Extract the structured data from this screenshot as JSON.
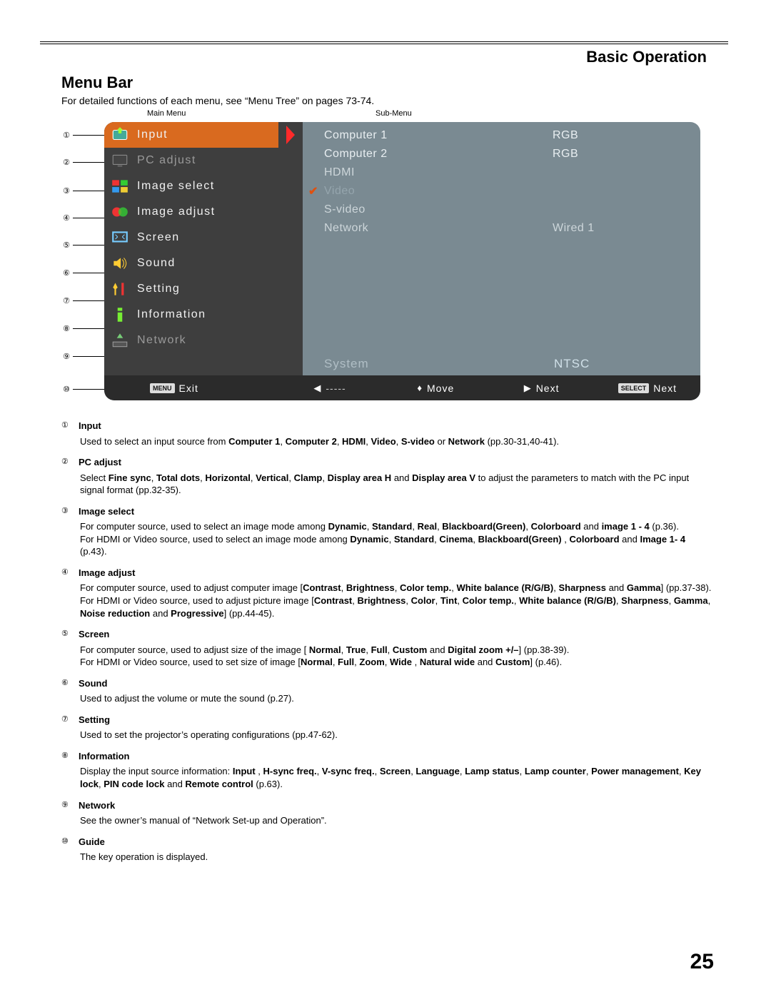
{
  "header": {
    "section": "Basic Operation",
    "title": "Menu Bar",
    "intro": "For detailed functions of each menu, see “Menu Tree” on pages 73-74.",
    "main_label": "Main Menu",
    "sub_label": "Sub-Menu"
  },
  "menu": {
    "items": [
      {
        "label": "Input",
        "selected": true
      },
      {
        "label": "PC adjust",
        "dim": true
      },
      {
        "label": "Image select"
      },
      {
        "label": "Image adjust"
      },
      {
        "label": "Screen"
      },
      {
        "label": "Sound"
      },
      {
        "label": "Setting"
      },
      {
        "label": "Information"
      },
      {
        "label": "Network",
        "dim": true
      }
    ]
  },
  "submenu": {
    "items": [
      {
        "label": "Computer 1",
        "value": "RGB",
        "bright": true
      },
      {
        "label": "Computer 2",
        "value": "RGB",
        "bright": true
      },
      {
        "label": "HDMI",
        "value": ""
      },
      {
        "label": "Video",
        "value": "",
        "checked": true,
        "dim": true
      },
      {
        "label": "S-video",
        "value": ""
      },
      {
        "label": "Network",
        "value": "Wired 1"
      }
    ],
    "system": {
      "label": "System",
      "value": "NTSC"
    }
  },
  "guide": {
    "exit_tag": "MENU",
    "exit": "Exit",
    "move": "Move",
    "next": "Next",
    "select_tag": "SELECT",
    "select": "Next",
    "dashes": "-----"
  },
  "descriptions": [
    {
      "num": "①",
      "head": "Input",
      "html": "Used to select an input source from <b>Computer 1</b>, <b>Computer 2</b>, <b>HDMI</b>, <b>Video</b>, <b>S-video</b> or <b>Network</b> (pp.30-31,40-41)."
    },
    {
      "num": "②",
      "head": "PC adjust",
      "html": "Select <b>Fine sync</b>, <b>Total dots</b>, <b>Horizontal</b>, <b>Vertical</b>, <b>Clamp</b>, <b>Display area H</b> and <b>Display area V</b> to adjust the parameters to match with the PC input signal format (pp.32-35)."
    },
    {
      "num": "③",
      "head": "Image select",
      "html": "For computer source, used to select an image mode among <b>Dynamic</b>, <b>Standard</b>, <b>Real</b>, <b>Blackboard(Green)</b>, <b>Colorboard</b> and <b>image 1 - 4</b> (p.36).<br>For HDMI or Video source, used to select an image mode among <b>Dynamic</b>, <b>Standard</b>, <b>Cinema</b>, <b>Blackboard(Green)</b> , <b>Colorboard</b> and <b>Image 1- 4</b> (p.43)."
    },
    {
      "num": "④",
      "head": "Image adjust",
      "html": "For computer source, used to adjust computer image [<b>Contrast</b>, <b>Brightness</b>, <b>Color temp.</b>, <b>White balance (R/G/B)</b>, <b>Sharpness</b> and <b>Gamma</b>] (pp.37-38).<br>For HDMI or Video source, used to adjust picture image [<b>Contrast</b>, <b>Brightness</b>, <b>Color</b>, <b>Tint</b>, <b>Color temp.</b>, <b>White balance (R/G/B)</b>, <b>Sharpness</b>, <b>Gamma</b>, <b>Noise reduction</b> and <b>Progressive</b>] (pp.44-45)."
    },
    {
      "num": "⑤",
      "head": "Screen",
      "html": "For computer source, used to adjust size of the image [ <b>Normal</b>, <b>True</b>, <b>Full</b>, <b>Custom</b> and <b>Digital zoom +/–</b>] (pp.38-39).<br>For HDMI or Video source, used to set size of image [<b>Normal</b>, <b>Full</b>, <b>Zoom</b>, <b>Wide</b> , <b>Natural wide</b> and <b>Custom</b>] (p.46)."
    },
    {
      "num": "⑥",
      "head": "Sound",
      "html": "Used to adjust the volume or mute the sound (p.27)."
    },
    {
      "num": "⑦",
      "head": "Setting",
      "html": "Used to set the projector’s operating configurations (pp.47-62)."
    },
    {
      "num": "⑧",
      "head": "Information",
      "html": "Display the input source information: <b>Input</b> , <b>H-sync freq.</b>, <b>V-sync freq.</b>, <b>Screen</b>, <b>Language</b>, <b>Lamp status</b>, <b>Lamp counter</b>, <b>Power management</b>, <b>Key lock</b>, <b>PIN code lock</b> and <b>Remote control</b> (p.63)."
    },
    {
      "num": "⑨",
      "head": "Network",
      "html": "See the owner’s manual of “Network Set-up and Operation”."
    },
    {
      "num": "⑩",
      "head": "Guide",
      "html": "The key operation is displayed."
    }
  ],
  "nums": [
    "①",
    "②",
    "③",
    "④",
    "⑤",
    "⑥",
    "⑦",
    "⑧",
    "⑨",
    "⑩"
  ],
  "page_number": "25"
}
